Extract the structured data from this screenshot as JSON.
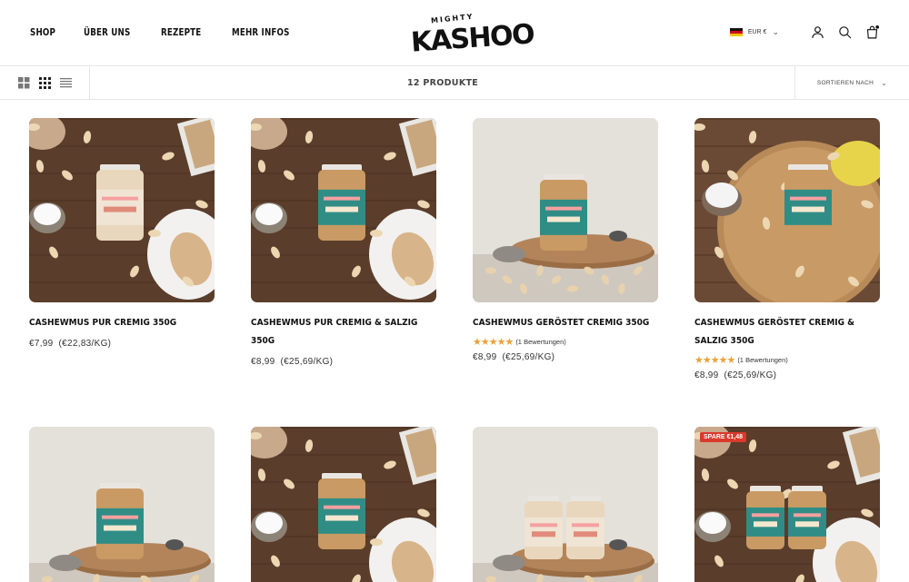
{
  "nav": {
    "items": [
      "SHOP",
      "ÜBER UNS",
      "REZEPTE",
      "MEHR INFOS"
    ]
  },
  "brand": {
    "top": "MIGHTY",
    "name": "KASHOO"
  },
  "locale": {
    "currency": "EUR €"
  },
  "toolbar": {
    "count": "12 PRODUKTE",
    "sort_label": "SORTIEREN NACH"
  },
  "icons": {
    "grid2": "grid-2-icon",
    "grid4": "grid-4-icon",
    "list": "list-icon",
    "account": "user-icon",
    "search": "search-icon",
    "cart": "bag-icon"
  },
  "colors": {
    "star": "#e8a23a",
    "badge": "#d93a2b",
    "jar_teal": "#2f8d86",
    "jar_light": "#f0e4d4"
  },
  "products": [
    {
      "title": "CASHEWMUS PUR CREMIG 350G",
      "price": "€7,99",
      "unit": "(€22,83/KG)",
      "rating": null,
      "reviews": "",
      "badge": ""
    },
    {
      "title": "CASHEWMUS PUR CREMIG & SALZIG 350G",
      "price": "€8,99",
      "unit": "(€25,69/KG)",
      "rating": null,
      "reviews": "",
      "badge": ""
    },
    {
      "title": "CASHEWMUS GERÖSTET CREMIG 350G",
      "price": "€8,99",
      "unit": "(€25,69/KG)",
      "rating": 5,
      "reviews": "(1 Bewertungen)",
      "badge": ""
    },
    {
      "title": "CASHEWMUS GERÖSTET CREMIG & SALZIG 350G",
      "price": "€8,99",
      "unit": "(€25,69/KG)",
      "rating": 5,
      "reviews": "(1 Bewertungen)",
      "badge": ""
    },
    {
      "title": "",
      "price": "",
      "unit": "",
      "rating": null,
      "reviews": "",
      "badge": ""
    },
    {
      "title": "",
      "price": "",
      "unit": "",
      "rating": null,
      "reviews": "",
      "badge": ""
    },
    {
      "title": "",
      "price": "",
      "unit": "",
      "rating": null,
      "reviews": "",
      "badge": ""
    },
    {
      "title": "",
      "price": "",
      "unit": "",
      "rating": null,
      "reviews": "",
      "badge": "SPARE €1,48"
    }
  ]
}
